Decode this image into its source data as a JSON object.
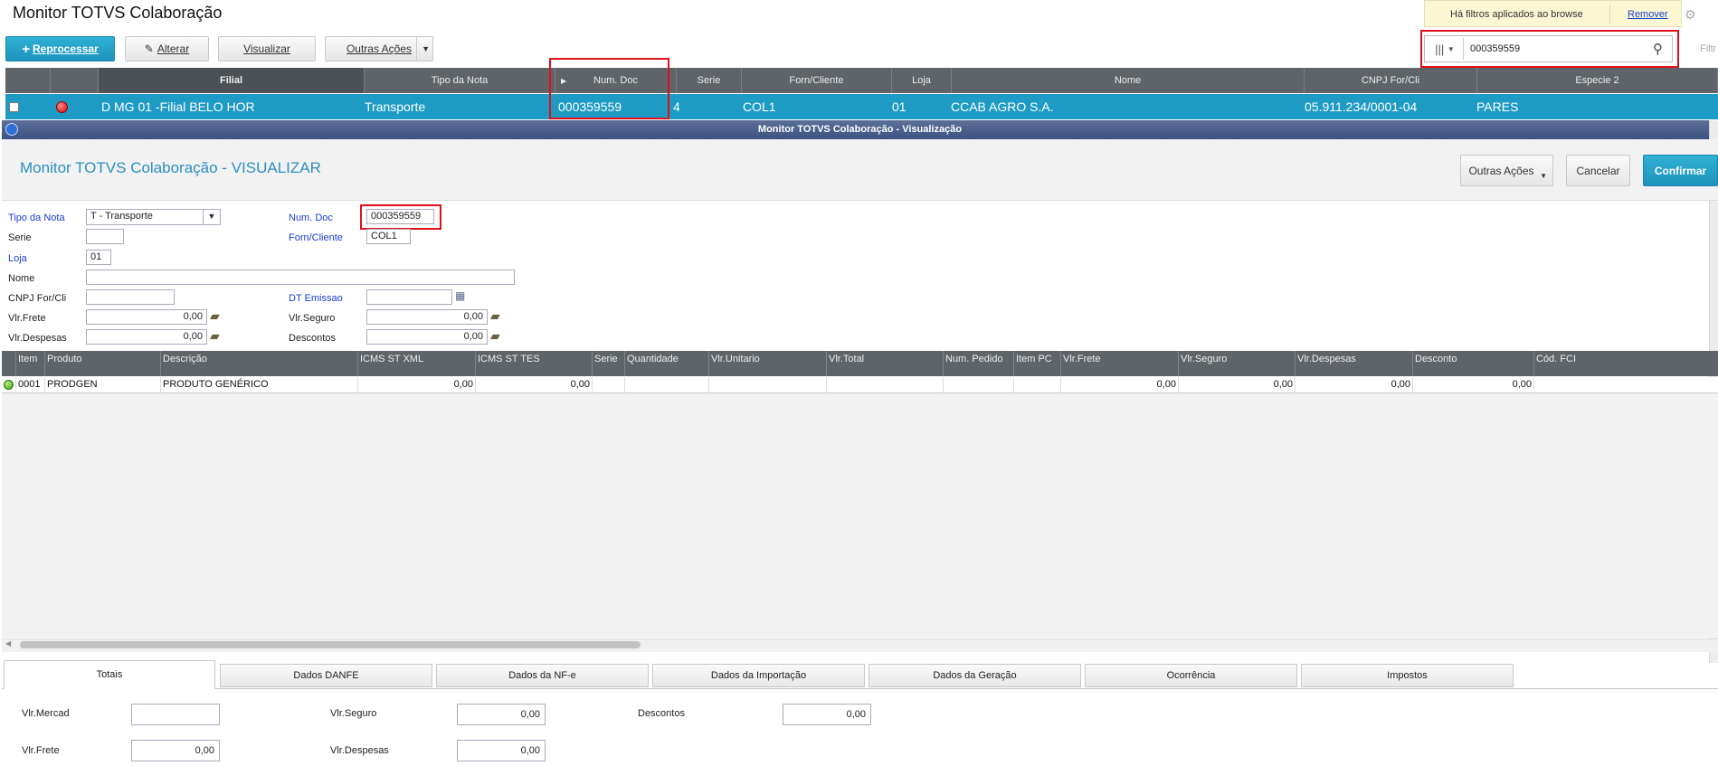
{
  "app": {
    "title": "Monitor TOTVS Colaboração",
    "filter_notice": "Há filtros aplicados ao browse",
    "filter_remove": "Remover",
    "filter_truncated": "Filtr"
  },
  "toolbar": {
    "reprocessar": "Reprocessar",
    "alterar": "Alterar",
    "visualizar": "Visualizar",
    "outras_acoes": "Outras Ações"
  },
  "search": {
    "value": "000359559"
  },
  "browse": {
    "columns": [
      "Filial",
      "Tipo da Nota",
      "Num. Doc",
      "Serie",
      "Forn/Cliente",
      "Loja",
      "Nome",
      "CNPJ For/Cli",
      "Especie 2"
    ],
    "row": {
      "filial": "D MG 01 -Filial BELO HOR",
      "tipo": "Transporte",
      "num_doc": "000359559",
      "serie": "4",
      "forn": "COL1",
      "loja": "01",
      "nome": "CCAB AGRO S.A.",
      "cnpj": "05.911.234/0001-04",
      "especie": "PARES"
    }
  },
  "window": {
    "title": "Monitor TOTVS Colaboração - Visualização",
    "header": "Monitor TOTVS Colaboração - VISUALIZAR",
    "outras_acoes": "Outras Ações",
    "cancelar": "Cancelar",
    "confirmar": "Confirmar"
  },
  "form": {
    "tipo_nota_label": "Tipo da Nota",
    "tipo_nota_value": "T - Transporte",
    "num_doc_label": "Num. Doc",
    "num_doc_value": "000359559",
    "serie_label": "Serie",
    "serie_value": "",
    "forn_label": "Forn/Cliente",
    "forn_value": "COL1",
    "loja_label": "Loja",
    "loja_value": "01",
    "nome_label": "Nome",
    "nome_value": "",
    "cnpj_label": "CNPJ For/Cli",
    "cnpj_value": "",
    "dt_emissao_label": "DT Emissao",
    "dt_emissao_value": "",
    "vlr_frete_label": "Vlr.Frete",
    "vlr_frete_value": "0,00",
    "vlr_seguro_label": "Vlr.Seguro",
    "vlr_seguro_value": "0,00",
    "vlr_despesas_label": "Vlr.Despesas",
    "vlr_despesas_value": "0,00",
    "descontos_label": "Descontos",
    "descontos_value": "0,00"
  },
  "items": {
    "columns": [
      "Item",
      "Produto",
      "Descrição",
      "ICMS ST XML",
      "ICMS ST TES",
      "Serie",
      "Quantidade",
      "Vlr.Unitario",
      "Vlr.Total",
      "Num. Pedido",
      "Item PC",
      "Vlr.Frete",
      "Vlr.Seguro",
      "Vlr.Despesas",
      "Desconto",
      "Cód. FCI"
    ],
    "row": {
      "item": "0001",
      "produto": "PRODGEN",
      "descricao": "PRODUTO GENÉRICO",
      "icms_xml": "0,00",
      "icms_tes": "0,00",
      "frete": "0,00",
      "seguro": "0,00",
      "despesas": "0,00",
      "desconto": "0,00"
    }
  },
  "tabs": [
    "Totais",
    "Dados DANFE",
    "Dados da NF-e",
    "Dados da Importação",
    "Dados da Geração",
    "Ocorrência",
    "Impostos"
  ],
  "totals": {
    "vlr_mercad_label": "Vlr.Mercad",
    "vlr_mercad_value": "",
    "vlr_seguro_label": "Vlr.Seguro",
    "vlr_seguro_value": "0,00",
    "descontos_label": "Descontos",
    "descontos_value": "0,00",
    "vlr_frete_label": "Vlr.Frete",
    "vlr_frete_value": "0,00",
    "vlr_despesas_label": "Vlr.Despesas",
    "vlr_despesas_value": "0,00"
  },
  "colors": {
    "accent": "#1e9bc4",
    "header_grey": "#5f6468",
    "title_blue": "#2a8fc1",
    "highlight_red": "#e0101a"
  }
}
